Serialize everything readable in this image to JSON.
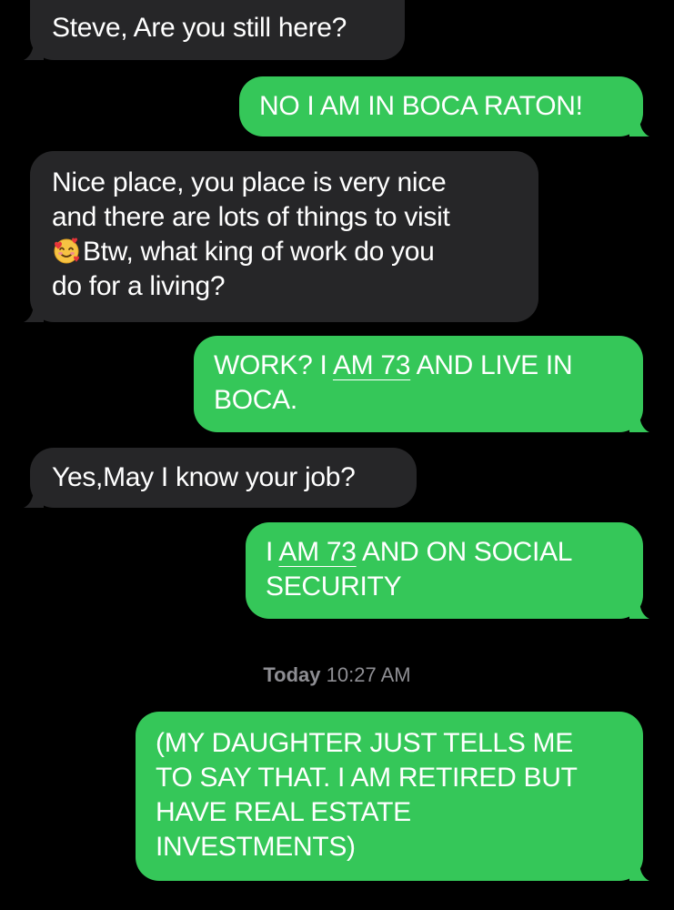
{
  "conversation": {
    "messages": [
      {
        "direction": "received",
        "lines": [
          "Steve, Are you still here?"
        ]
      },
      {
        "direction": "sent",
        "lines": [
          "NO I AM IN BOCA RATON!"
        ]
      },
      {
        "direction": "received",
        "lines": [
          "Nice place, you place is very nice",
          "and there are lots of things to visit",
          "Btw, what king of work do you",
          "do for a living?"
        ],
        "emoji": "smiling-face-with-hearts"
      },
      {
        "direction": "sent",
        "line1_prefix": "WORK? I ",
        "line1_link": "AM 73",
        "line1_suffix": " AND LIVE IN",
        "line2": "BOCA."
      },
      {
        "direction": "received",
        "lines": [
          "Yes,May I know your job?"
        ]
      },
      {
        "direction": "sent",
        "line1_prefix": "I ",
        "line1_link": "AM 73",
        "line1_suffix": " AND ON SOCIAL",
        "line2": "SECURITY"
      },
      {
        "direction": "sent",
        "lines": [
          "(MY DAUGHTER JUST TELLS ME",
          "TO SAY THAT. I AM RETIRED BUT",
          "HAVE REAL ESTATE",
          "INVESTMENTS)"
        ]
      }
    ],
    "timestamp": {
      "day": "Today",
      "time": "10:27 AM"
    }
  },
  "colors": {
    "background": "#000000",
    "received_bubble": "#262628",
    "sent_bubble": "#35c759",
    "timestamp_text": "#8e8e93"
  }
}
